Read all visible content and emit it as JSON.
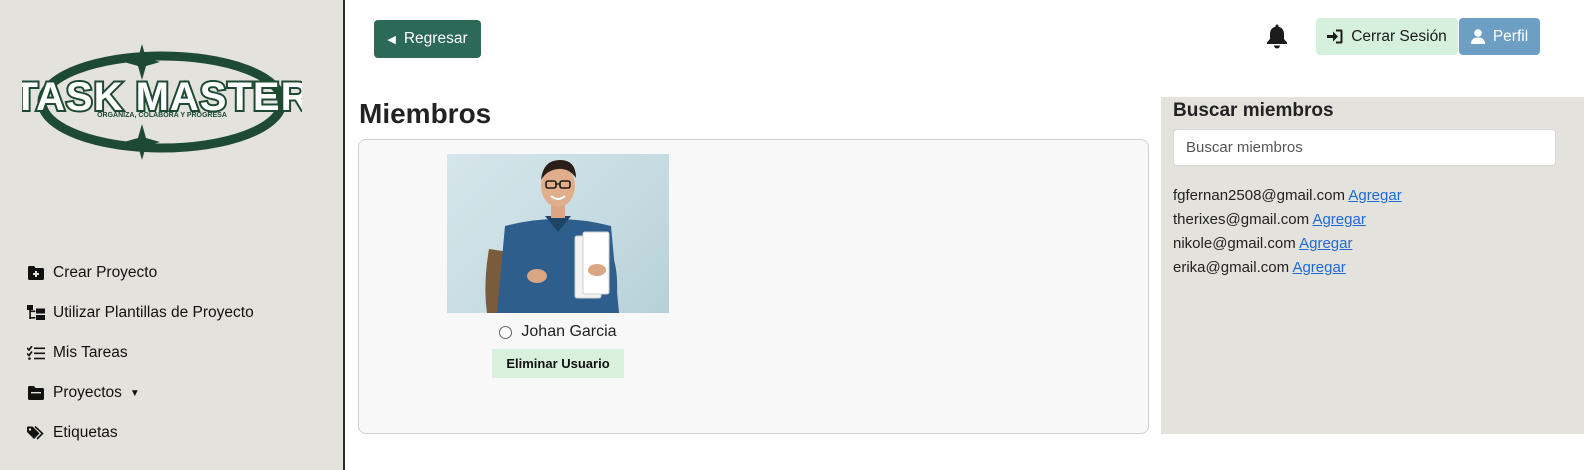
{
  "logo": {
    "title": "TASK MASTER",
    "tagline": "ORGANIZA, COLABORA Y PROGRESA"
  },
  "sidebar": {
    "items": [
      {
        "label": "Crear Proyecto",
        "icon": "folder-plus-icon"
      },
      {
        "label": "Utilizar Plantillas de Proyecto",
        "icon": "sitemap-icon"
      },
      {
        "label": "Mis Tareas",
        "icon": "list-check-icon"
      },
      {
        "label": "Proyectos",
        "icon": "folder-icon"
      },
      {
        "label": "Etiquetas",
        "icon": "tags-icon"
      }
    ]
  },
  "header": {
    "back_label": "Regresar",
    "logout_label": "Cerrar Sesión",
    "profile_label": "Perfil"
  },
  "main": {
    "title": "Miembros",
    "members": [
      {
        "name": "Johan Garcia",
        "delete_label": "Eliminar Usuario"
      }
    ]
  },
  "search": {
    "title": "Buscar miembros",
    "placeholder": "Buscar miembros",
    "add_label": "Agregar",
    "results": [
      "fgfernan2508@gmail.com",
      "therixes@gmail.com",
      "nikole@gmail.com",
      "erika@gmail.com"
    ]
  },
  "colors": {
    "accent_green": "#2c6a57",
    "logo_green": "#1e4a33",
    "light_green": "#d5f0dd",
    "profile_blue": "#6d9ec4",
    "link_blue": "#1d6ad8",
    "sidebar_bg": "#e3e2dc"
  }
}
